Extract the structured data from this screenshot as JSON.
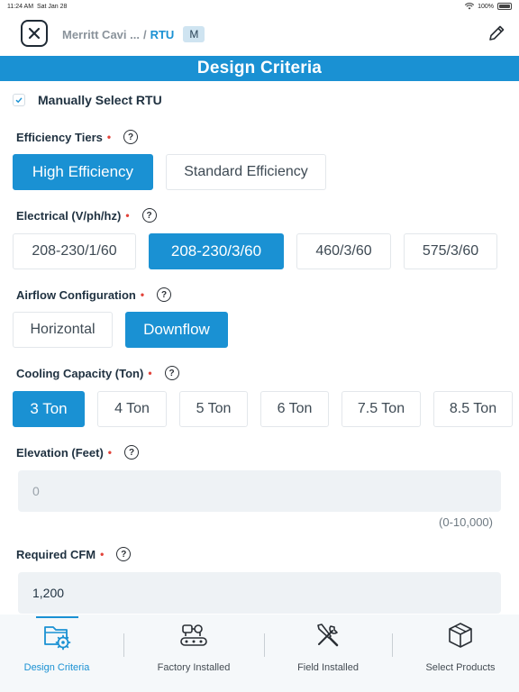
{
  "status_bar": {
    "time": "11:24 AM",
    "date": "Sat Jan 28",
    "battery": "100%"
  },
  "header": {
    "breadcrumb_parent": "Merritt Cavi ...",
    "breadcrumb_separator": "/",
    "breadcrumb_current": "RTU",
    "badge": "M"
  },
  "section": {
    "title": "Design Criteria"
  },
  "manual_select": {
    "label": "Manually Select RTU",
    "checked": true
  },
  "efficiency": {
    "label": "Efficiency Tiers",
    "required_mark": "•",
    "options": [
      "High Efficiency",
      "Standard Efficiency"
    ],
    "selected": "High Efficiency"
  },
  "electrical": {
    "label": "Electrical (V/ph/hz)",
    "required_mark": "•",
    "options": [
      "208-230/1/60",
      "208-230/3/60",
      "460/3/60",
      "575/3/60"
    ],
    "selected": "208-230/3/60"
  },
  "airflow": {
    "label": "Airflow Configuration",
    "required_mark": "•",
    "options": [
      "Horizontal",
      "Downflow"
    ],
    "selected": "Downflow"
  },
  "cooling": {
    "label": "Cooling Capacity (Ton)",
    "required_mark": "•",
    "options": [
      "3 Ton",
      "4 Ton",
      "5 Ton",
      "6 Ton",
      "7.5 Ton",
      "8.5 Ton"
    ],
    "selected": "3 Ton"
  },
  "elevation": {
    "label": "Elevation (Feet)",
    "required_mark": "•",
    "placeholder": "0",
    "value": "",
    "range_hint": "(0-10,000)"
  },
  "cfm": {
    "label": "Required CFM",
    "required_mark": "•",
    "value": "1,200"
  },
  "help_glyph": "?",
  "tabs": [
    {
      "label": "Design Criteria",
      "icon": "folder-gear-icon"
    },
    {
      "label": "Factory Installed",
      "icon": "conveyor-icon"
    },
    {
      "label": "Field Installed",
      "icon": "tools-icon"
    },
    {
      "label": "Select Products",
      "icon": "box-icon"
    }
  ],
  "active_tab": "Design Criteria",
  "colors": {
    "accent": "#1a91d3",
    "required": "#e2433a",
    "input_bg": "#eef2f5"
  }
}
